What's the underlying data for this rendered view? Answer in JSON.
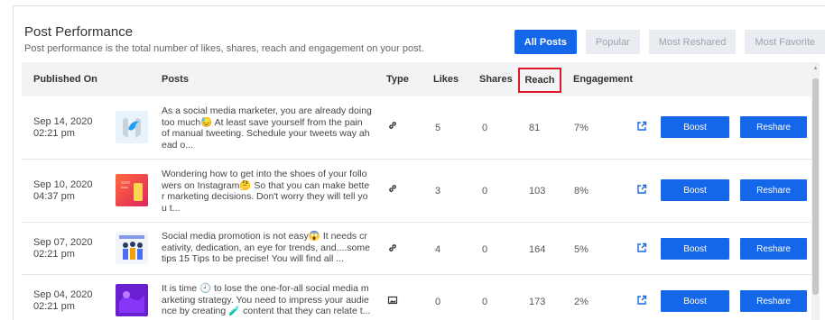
{
  "header": {
    "title": "Post Performance",
    "subtitle": "Post performance is the total number of likes, shares, reach and engagement on your post."
  },
  "filters": [
    "All Posts",
    "Popular",
    "Most Reshared",
    "Most Favorite"
  ],
  "columns": {
    "published": "Published On",
    "posts": "Posts",
    "type": "Type",
    "likes": "Likes",
    "shares": "Shares",
    "reach": "Reach",
    "engagement": "Engagement"
  },
  "rows": [
    {
      "date": "Sep 14, 2020",
      "time": "02:21 pm",
      "text": "As a social media marketer, you are already doing too much😓 At least save yourself from the pain of manual tweeting. Schedule your tweets way ah ead o...",
      "type_icon": "link-icon",
      "likes": "5",
      "shares": "0",
      "reach": "81",
      "engagement": "7%",
      "boost": "Boost",
      "reshare": "Reshare"
    },
    {
      "date": "Sep 10, 2020",
      "time": "04:37 pm",
      "text": "Wondering how to get into the shoes of your follo wers on Instagram🤔 So that you can make bette r marketing decisions. Don't worry they will tell yo u t...",
      "type_icon": "link-icon",
      "likes": "3",
      "shares": "0",
      "reach": "103",
      "engagement": "8%",
      "boost": "Boost",
      "reshare": "Reshare"
    },
    {
      "date": "Sep 07, 2020",
      "time": "02:21 pm",
      "text": "Social media promotion is not easy😱 It needs cr eativity, dedication, an eye for trends, and....some tips 15 Tips to be precise! You will find all ...",
      "type_icon": "link-icon",
      "likes": "4",
      "shares": "0",
      "reach": "164",
      "engagement": "5%",
      "boost": "Boost",
      "reshare": "Reshare"
    },
    {
      "date": "Sep 04, 2020",
      "time": "02:21 pm",
      "text": "It is time 🕘 to lose the one-for-all social media m arketing strategy. You need to impress your audie nce by creating 🧪 content that they can relate t...",
      "type_icon": "image-icon",
      "likes": "0",
      "shares": "0",
      "reach": "173",
      "engagement": "2%",
      "boost": "Boost",
      "reshare": "Reshare"
    }
  ]
}
